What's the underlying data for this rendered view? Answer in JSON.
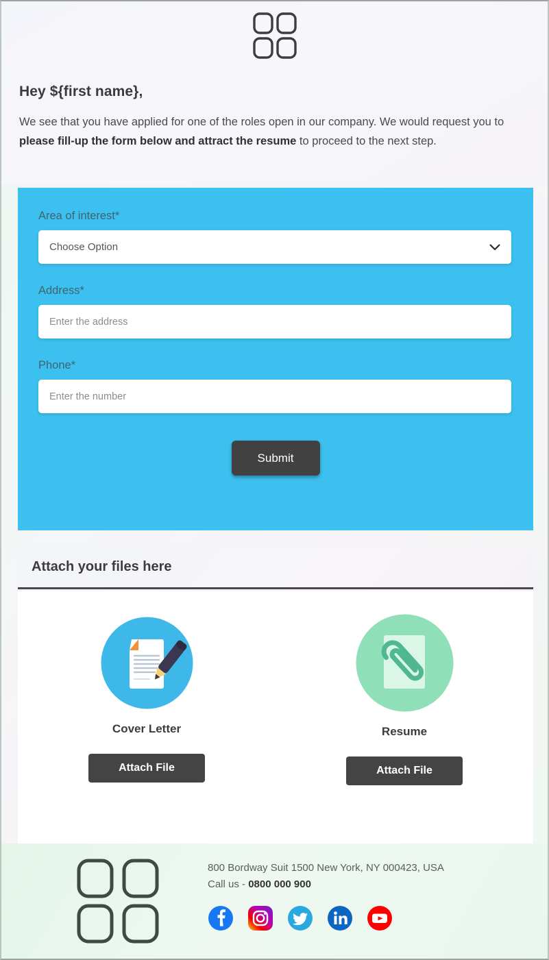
{
  "brand": {
    "logo_icon": "four-rounded-squares-logo",
    "logo_color": "#3d3d3d",
    "footer_logo_color": "#3e4a42"
  },
  "intro": {
    "greeting": "Hey ${first name},",
    "body_part1": "We see that you have applied for one of the roles open in our company. We would request you to ",
    "body_bold": "please fill-up the form below and attract the resume",
    "body_part2": " to proceed to the next step."
  },
  "form": {
    "background_color": "#3cc0ef",
    "fields": [
      {
        "label": "Area of interest*",
        "type": "select",
        "value": "Choose Option",
        "icon": "chevron-down-icon"
      },
      {
        "label": "Address*",
        "type": "text",
        "value": "",
        "placeholder": "Enter the address"
      },
      {
        "label": "Phone*",
        "type": "text",
        "value": "",
        "placeholder": "Enter the number"
      }
    ],
    "submit_label": "Submit",
    "submit_color": "#414141"
  },
  "attach": {
    "heading": "Attach your files here",
    "items": [
      {
        "title": "Cover Letter",
        "button_label": "Attach File",
        "icon": "document-with-pen-icon",
        "circle_color": "#3eb8e8"
      },
      {
        "title": "Resume",
        "button_label": "Attach File",
        "icon": "document-with-paperclip-icon",
        "circle_color": "#8fe0b8"
      }
    ]
  },
  "footer": {
    "address": "800 Bordway Suit 1500 New York, NY 000423, USA",
    "call_prefix": "Call us - ",
    "phone": "0800 000 900",
    "socials": [
      {
        "name": "facebook-icon",
        "color": "#1877f2"
      },
      {
        "name": "instagram-icon",
        "color": "#e1306c"
      },
      {
        "name": "twitter-icon",
        "color": "#1da1f2"
      },
      {
        "name": "linkedin-icon",
        "color": "#0a66c2"
      },
      {
        "name": "youtube-icon",
        "color": "#ff0000"
      }
    ]
  }
}
